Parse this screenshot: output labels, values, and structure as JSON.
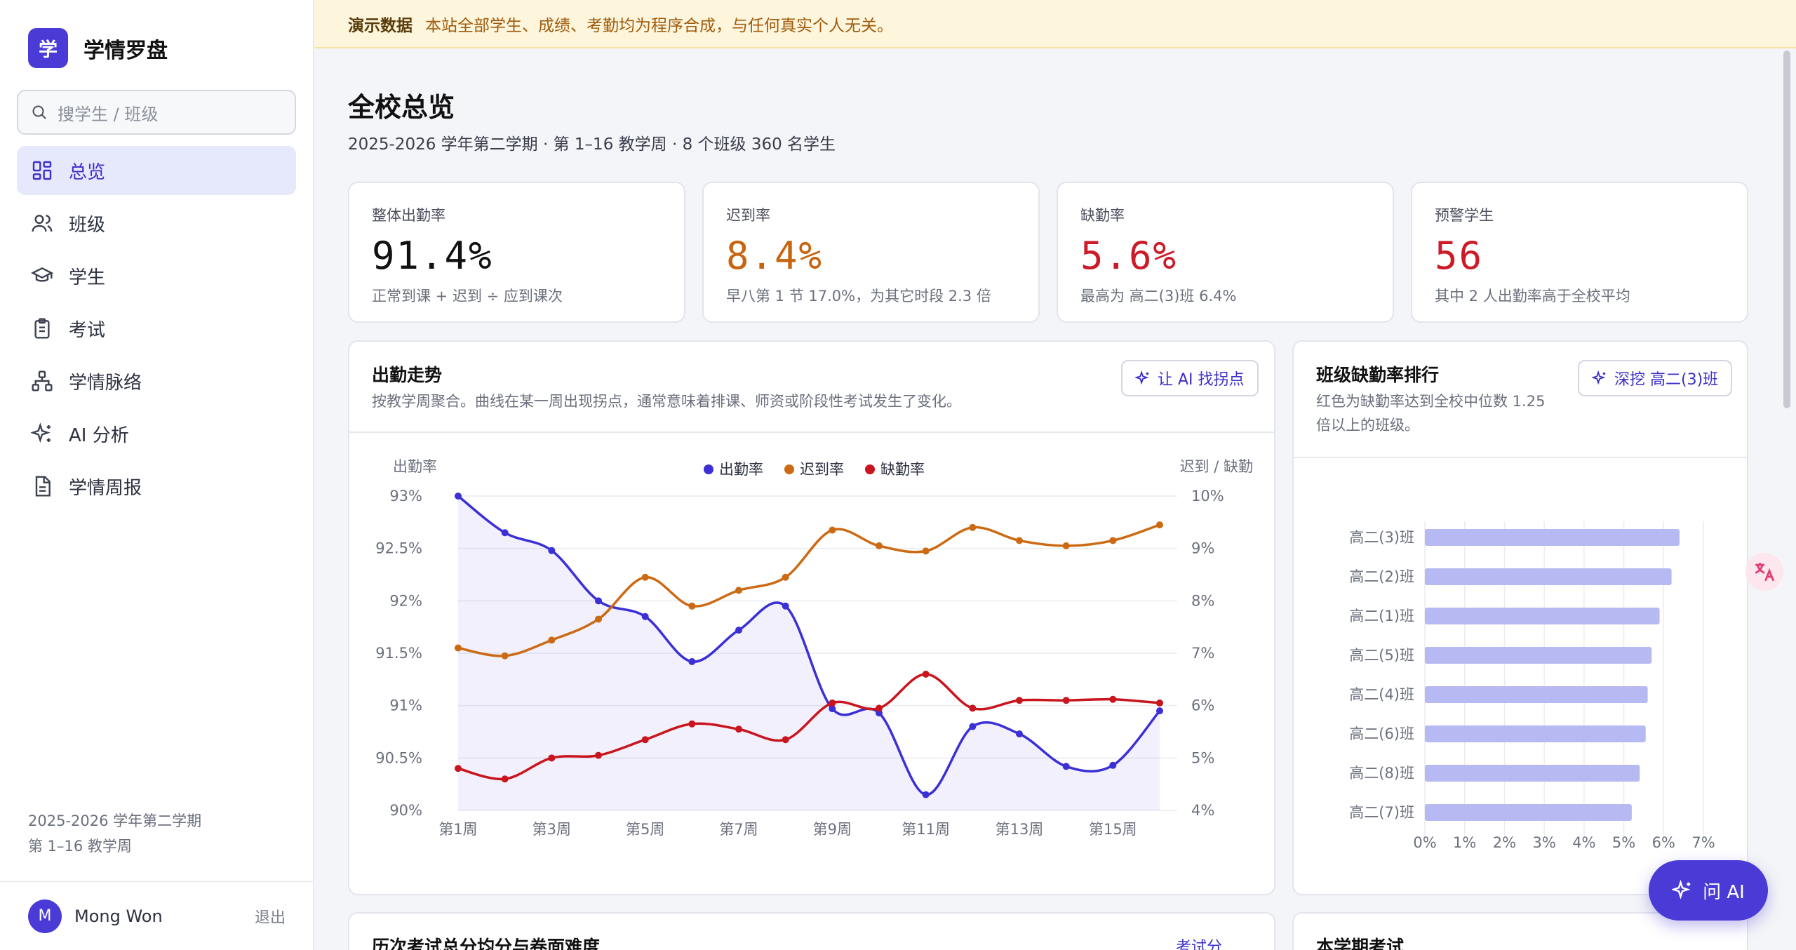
{
  "brand": {
    "logo": "学",
    "name": "学情罗盘"
  },
  "search": {
    "placeholder": "搜学生 / 班级"
  },
  "nav": [
    {
      "label": "总览",
      "icon": "grid-icon",
      "active": true
    },
    {
      "label": "班级",
      "icon": "users-icon"
    },
    {
      "label": "学生",
      "icon": "graduation-cap-icon"
    },
    {
      "label": "考试",
      "icon": "clipboard-icon"
    },
    {
      "label": "学情脉络",
      "icon": "network-icon"
    },
    {
      "label": "AI 分析",
      "icon": "sparkles-icon"
    },
    {
      "label": "学情周报",
      "icon": "document-icon"
    }
  ],
  "term": {
    "line1": "2025-2026 学年第二学期",
    "line2": "第 1–16 教学周"
  },
  "user": {
    "initial": "M",
    "name": "Mong Won",
    "logout": "退出"
  },
  "banner": {
    "tag": "演示数据",
    "text": "本站全部学生、成绩、考勤均为程序合成，与任何真实个人无关。"
  },
  "page": {
    "title": "全校总览",
    "subtitle": "2025-2026 学年第二学期 · 第 1–16 教学周 · 8 个班级 360 名学生"
  },
  "kpis": [
    {
      "label": "整体出勤率",
      "value": "91.4%",
      "note": "正常到课 + 迟到 ÷ 应到课次",
      "color": "#111111"
    },
    {
      "label": "迟到率",
      "value": "8.4%",
      "note": "早八第 1 节 17.0%，为其它时段 2.3 倍",
      "color": "#c8640f"
    },
    {
      "label": "缺勤率",
      "value": "5.6%",
      "note": "最高为 高二(3)班 6.4%",
      "color": "#cc1a28"
    },
    {
      "label": "预警学生",
      "value": "56",
      "note": "其中 2 人出勤率高于全校平均",
      "color": "#cc1a28"
    }
  ],
  "attendance_card": {
    "title": "出勤走势",
    "desc": "按教学周聚合。曲线在某一周出现拐点，通常意味着排课、师资或阶段性考试发生了变化。",
    "button": "让 AI 找拐点"
  },
  "ranking_card": {
    "title": "班级缺勤率排行",
    "desc_line1": "红色为缺勤率达到全校中位数 1.25",
    "desc_line2": "倍以上的班级。",
    "button": "深挖 高二(3)班"
  },
  "bottom_cards": {
    "exam_title": "历次考试总分均分与卷面难度",
    "exam_link": "考试分",
    "term_exam_title": "本学期考试"
  },
  "ask_ai": "问 AI",
  "chart_data": [
    {
      "type": "line",
      "left_axis_label": "出勤率",
      "right_axis_label": "迟到 / 缺勤",
      "ylim_left": [
        90,
        93
      ],
      "ylim_right": [
        4,
        10
      ],
      "left_ticks": [
        "90%",
        "90.5%",
        "91%",
        "91.5%",
        "92%",
        "92.5%",
        "93%"
      ],
      "right_ticks": [
        "4%",
        "5%",
        "6%",
        "7%",
        "8%",
        "9%",
        "10%"
      ],
      "x": [
        "第1周",
        "第2周",
        "第3周",
        "第4周",
        "第5周",
        "第6周",
        "第7周",
        "第8周",
        "第9周",
        "第10周",
        "第11周",
        "第12周",
        "第13周",
        "第14周",
        "第15周",
        "第16周"
      ],
      "x_tick_labels": [
        "第1周",
        "第3周",
        "第5周",
        "第7周",
        "第9周",
        "第11周",
        "第13周",
        "第15周"
      ],
      "series": [
        {
          "name": "出勤率",
          "axis": "left",
          "color": "#3b2fd6",
          "values": [
            93.0,
            92.65,
            92.48,
            92.0,
            91.85,
            91.42,
            91.72,
            91.95,
            90.97,
            90.93,
            90.15,
            90.8,
            90.73,
            90.42,
            90.43,
            90.95
          ]
        },
        {
          "name": "迟到率",
          "axis": "right",
          "color": "#cc6a14",
          "values": [
            7.1,
            6.95,
            7.25,
            7.65,
            8.45,
            7.9,
            8.2,
            8.45,
            9.35,
            9.05,
            8.95,
            9.4,
            9.15,
            9.05,
            9.15,
            9.45
          ]
        },
        {
          "name": "缺勤率",
          "axis": "right",
          "color": "#c8151e",
          "values": [
            4.8,
            4.6,
            5.0,
            5.05,
            5.35,
            5.65,
            5.55,
            5.35,
            6.05,
            5.95,
            6.6,
            5.95,
            6.1,
            6.1,
            6.12,
            6.05
          ]
        }
      ]
    },
    {
      "type": "bar",
      "orientation": "horizontal",
      "categories": [
        "高二(3)班",
        "高二(2)班",
        "高二(1)班",
        "高二(5)班",
        "高二(4)班",
        "高二(6)班",
        "高二(8)班",
        "高二(7)班"
      ],
      "values": [
        6.4,
        6.2,
        5.9,
        5.7,
        5.6,
        5.55,
        5.4,
        5.2
      ],
      "xlim": [
        0,
        7
      ],
      "x_ticks": [
        "0%",
        "1%",
        "2%",
        "3%",
        "4%",
        "5%",
        "6%",
        "7%"
      ],
      "bar_color": "#b7b9f3"
    }
  ]
}
